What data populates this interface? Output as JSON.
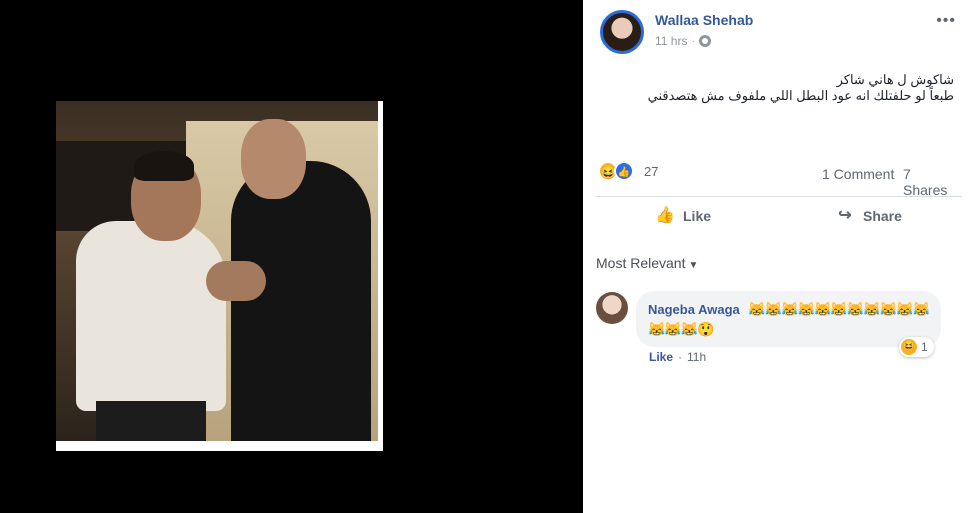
{
  "post": {
    "author": "Wallaa Shehab",
    "time": "11 hrs",
    "dot": "·",
    "more": "•••",
    "text_line1": "شاكوش ل هاني شاكر",
    "text_line2": "طبعاً لو حلفتلك انه عود البطل اللي ملفوف مش هتصدقني",
    "reactions_count": "27",
    "comments_label": "1 Comment",
    "shares_label": "7 Shares",
    "like_label": "Like",
    "share_label": "Share"
  },
  "comments": {
    "sort_label": "Most Relevant",
    "items": [
      {
        "name": "Nageba Awaga",
        "text": "😹😹😹😹😹😹😹😹😹😹😹😹😹😹😲",
        "reactions": "1",
        "like_label": "Like",
        "dot": "·",
        "time": "11h"
      }
    ]
  },
  "icons": {
    "haha": "😆",
    "like": "👍",
    "like_action": "👍",
    "share_action": "↪"
  }
}
